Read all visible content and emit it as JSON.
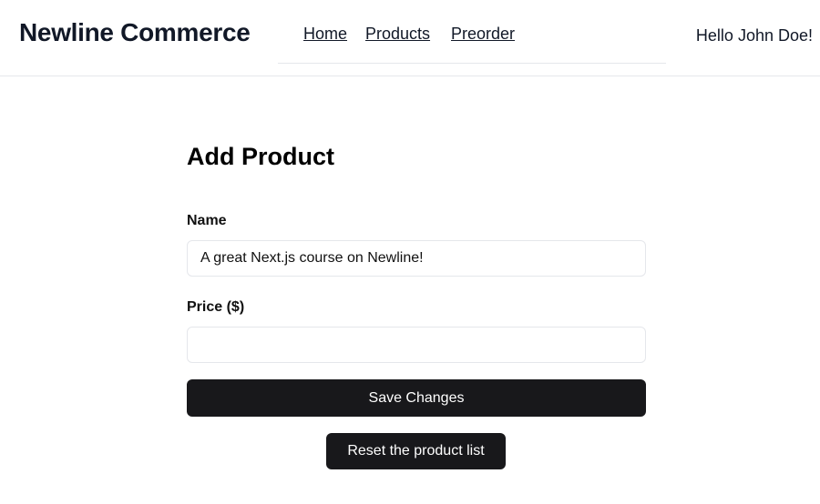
{
  "header": {
    "brand": "Newline Commerce",
    "nav": [
      "Home",
      "Products",
      "Preorder"
    ],
    "greeting": "Hello John Doe!"
  },
  "form": {
    "title": "Add Product",
    "name_label": "Name",
    "name_value": "A great Next.js course on Newline!",
    "price_label": "Price ($)",
    "price_value": "",
    "save_label": "Save Changes",
    "reset_label": "Reset the product list"
  }
}
